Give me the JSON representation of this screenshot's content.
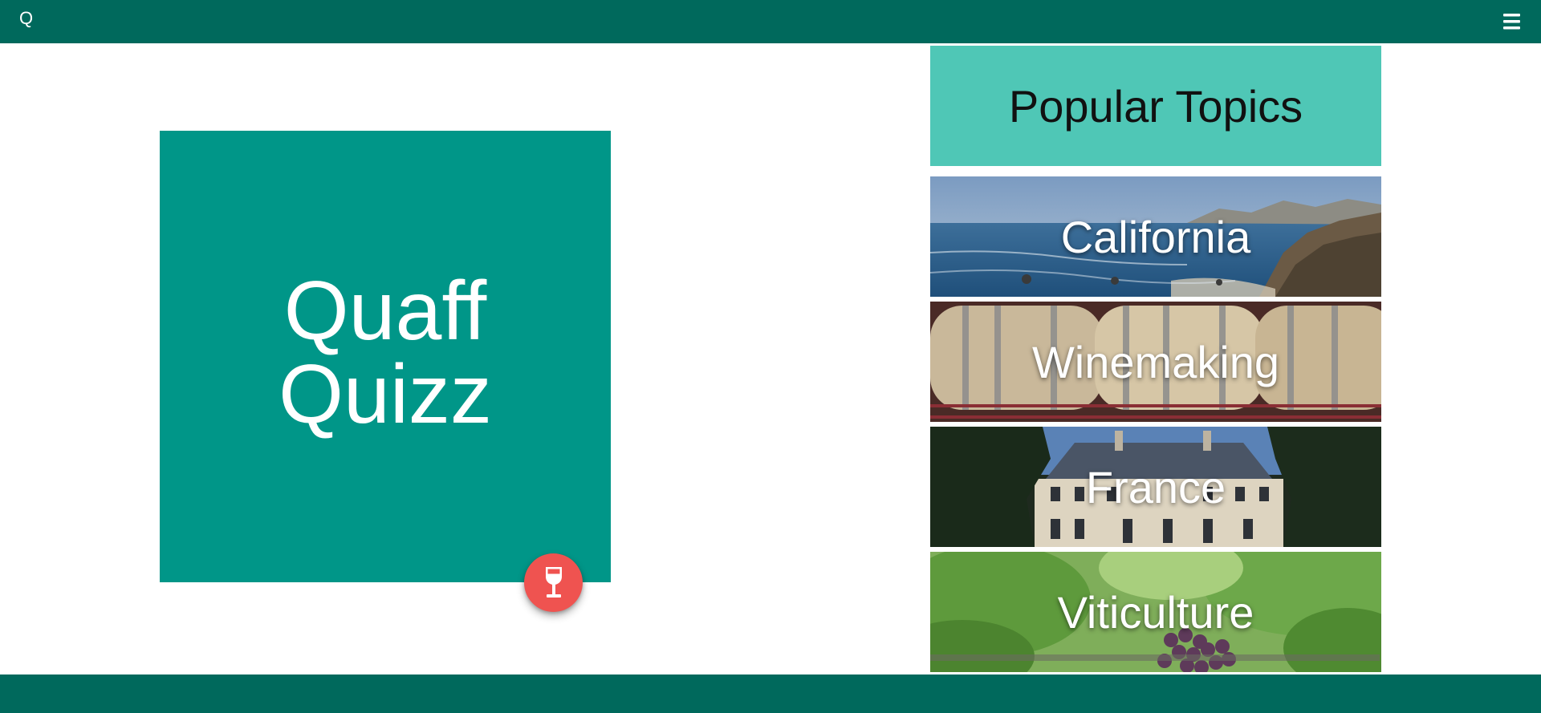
{
  "header": {
    "brand_letter": "Q",
    "menu_icon": "hamburger-menu-icon"
  },
  "hero": {
    "title": "Quaff\nQuizz",
    "fab_icon": "wine-glass-icon"
  },
  "topics": {
    "heading": "Popular Topics",
    "items": [
      {
        "label": "California",
        "image": "coastline-photo"
      },
      {
        "label": "Winemaking",
        "image": "wine-barrels-photo"
      },
      {
        "label": "France",
        "image": "chateau-photo"
      },
      {
        "label": "Viticulture",
        "image": "grapevine-photo"
      }
    ]
  },
  "colors": {
    "primary_dark": "#00695c",
    "primary": "#009688",
    "accent_light": "#4fc7b6",
    "fab": "#ef5350"
  }
}
